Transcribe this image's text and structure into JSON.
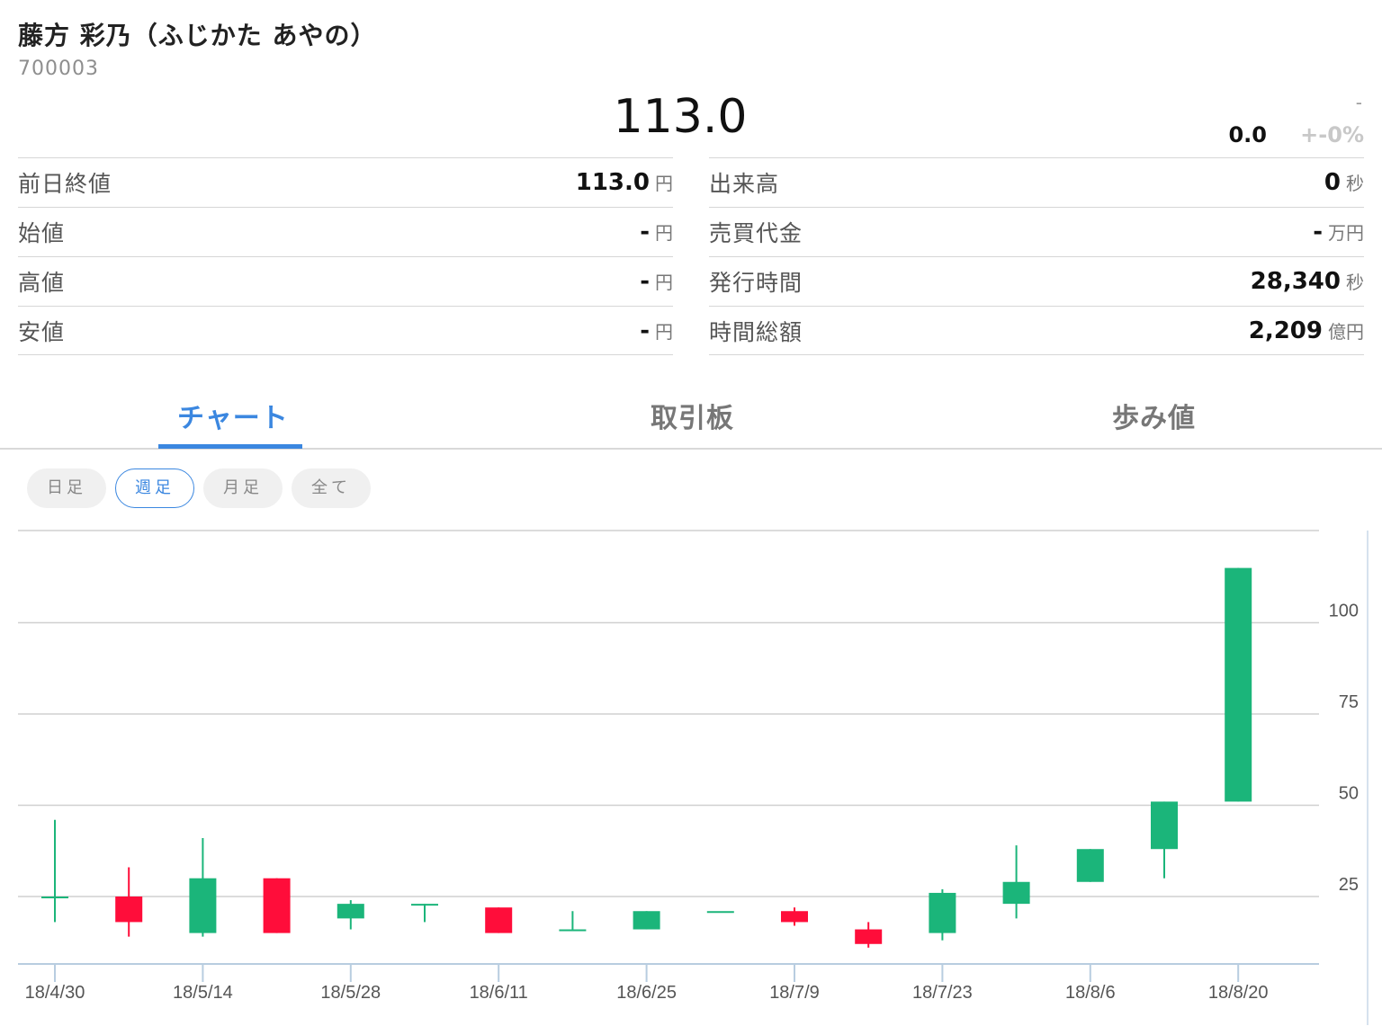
{
  "header": {
    "title": "藤方 彩乃（ふじかた あやの）",
    "code": "700003",
    "price": "113.0",
    "dash": "-",
    "change": "0.0",
    "change_pct": "+-0%"
  },
  "stats_left": [
    {
      "label": "前日終値",
      "value": "113.0",
      "unit": "円"
    },
    {
      "label": "始値",
      "value": "-",
      "unit": "円"
    },
    {
      "label": "高値",
      "value": "-",
      "unit": "円"
    },
    {
      "label": "安値",
      "value": "-",
      "unit": "円"
    }
  ],
  "stats_right": [
    {
      "label": "出来高",
      "value": "0",
      "unit": "秒"
    },
    {
      "label": "売買代金",
      "value": "-",
      "unit": "万円"
    },
    {
      "label": "発行時間",
      "value": "28,340",
      "unit": "秒"
    },
    {
      "label": "時間総額",
      "value": "2,209",
      "unit": "億円"
    }
  ],
  "tabs": [
    "チャート",
    "取引板",
    "歩み値"
  ],
  "periods": [
    "日足",
    "週足",
    "月足",
    "全て"
  ],
  "colors": {
    "up": "#1bb57a",
    "down": "#ff0d3a",
    "accent": "#3b87e0"
  },
  "chart_data": {
    "type": "candlestick",
    "y_ticks": [
      25,
      50,
      75,
      100
    ],
    "ylim": [
      6,
      126
    ],
    "x_ticks": [
      "18/4/30",
      "18/5/14",
      "18/5/28",
      "18/6/11",
      "18/6/25",
      "18/7/9",
      "18/7/23",
      "18/8/6",
      "18/8/20"
    ],
    "x_tick_index": [
      0,
      2,
      4,
      6,
      8,
      10,
      12,
      14,
      16
    ],
    "candles": [
      {
        "date": "18/4/30",
        "open": 25,
        "high": 46,
        "low": 18,
        "close": 25
      },
      {
        "date": "18/5/7",
        "open": 25,
        "high": 33,
        "low": 14,
        "close": 18
      },
      {
        "date": "18/5/14",
        "open": 15,
        "high": 41,
        "low": 14,
        "close": 30
      },
      {
        "date": "18/5/21",
        "open": 30,
        "high": 30,
        "low": 15,
        "close": 15
      },
      {
        "date": "18/5/28",
        "open": 19,
        "high": 24,
        "low": 16,
        "close": 23
      },
      {
        "date": "18/6/4",
        "open": 23,
        "high": 23,
        "low": 18,
        "close": 23
      },
      {
        "date": "18/6/11",
        "open": 22,
        "high": 22,
        "low": 15,
        "close": 15
      },
      {
        "date": "18/6/18",
        "open": 16,
        "high": 21,
        "low": 16,
        "close": 16
      },
      {
        "date": "18/6/25",
        "open": 16,
        "high": 21,
        "low": 16,
        "close": 21
      },
      {
        "date": "18/7/2",
        "open": 21,
        "high": 21,
        "low": 21,
        "close": 21
      },
      {
        "date": "18/7/9",
        "open": 21,
        "high": 22,
        "low": 17,
        "close": 18
      },
      {
        "date": "18/7/16",
        "open": 16,
        "high": 18,
        "low": 11,
        "close": 12
      },
      {
        "date": "18/7/23",
        "open": 15,
        "high": 27,
        "low": 13,
        "close": 26
      },
      {
        "date": "18/7/30",
        "open": 23,
        "high": 39,
        "low": 19,
        "close": 29
      },
      {
        "date": "18/8/6",
        "open": 29,
        "high": 38,
        "low": 29,
        "close": 38
      },
      {
        "date": "18/8/13",
        "open": 38,
        "high": 51,
        "low": 30,
        "close": 51
      },
      {
        "date": "18/8/20",
        "open": 51,
        "high": 115,
        "low": 51,
        "close": 115
      }
    ]
  }
}
